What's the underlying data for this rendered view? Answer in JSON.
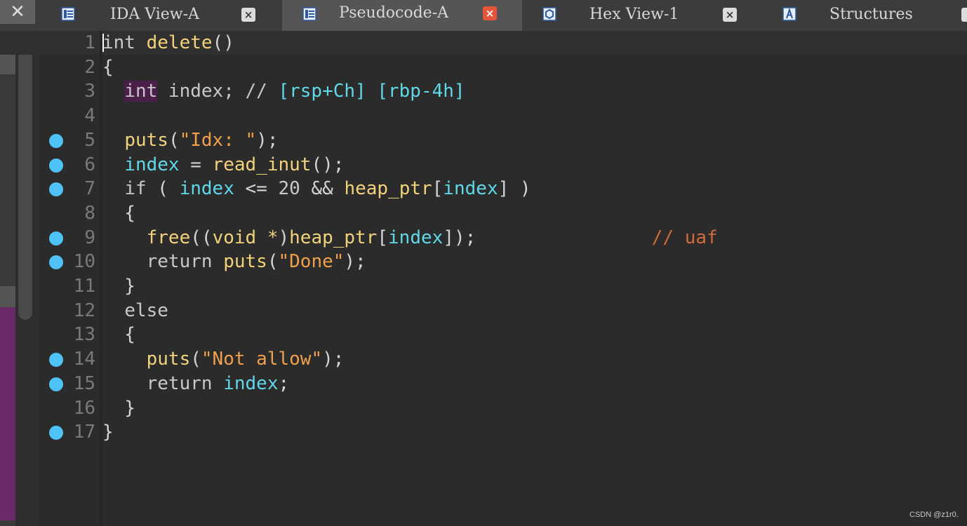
{
  "tabs": [
    {
      "label": "IDA View-A",
      "icon": "disassembly-view-icon",
      "active": false
    },
    {
      "label": "Pseudocode-A",
      "icon": "pseudocode-view-icon",
      "active": true
    },
    {
      "label": "Hex View-1",
      "icon": "hex-view-icon",
      "active": false
    },
    {
      "label": "Structures",
      "icon": "structures-icon",
      "active": false
    }
  ],
  "close_all_glyph": "✕",
  "tab_close_glyph": "×",
  "code": {
    "lines": [
      {
        "n": "1",
        "bp": false,
        "tokens": [
          {
            "t": "int",
            "c": "kw"
          },
          {
            "t": " ",
            "c": "punc"
          },
          {
            "t": "delete",
            "c": "fn"
          },
          {
            "t": "()",
            "c": "punc"
          }
        ]
      },
      {
        "n": "2",
        "bp": false,
        "tokens": [
          {
            "t": "{",
            "c": "punc"
          }
        ]
      },
      {
        "n": "3",
        "bp": false,
        "tokens": [
          {
            "t": "  ",
            "c": "punc"
          },
          {
            "t": "int",
            "c": "kw-bg"
          },
          {
            "t": " index; // ",
            "c": "kw"
          },
          {
            "t": "[rsp+Ch] [rbp-4h]",
            "c": "var"
          }
        ]
      },
      {
        "n": "4",
        "bp": false,
        "tokens": []
      },
      {
        "n": "5",
        "bp": true,
        "tokens": [
          {
            "t": "  ",
            "c": "punc"
          },
          {
            "t": "puts",
            "c": "fn"
          },
          {
            "t": "(",
            "c": "punc"
          },
          {
            "t": "\"Idx: \"",
            "c": "str"
          },
          {
            "t": ");",
            "c": "punc"
          }
        ]
      },
      {
        "n": "6",
        "bp": true,
        "tokens": [
          {
            "t": "  ",
            "c": "punc"
          },
          {
            "t": "index",
            "c": "var"
          },
          {
            "t": " = ",
            "c": "punc"
          },
          {
            "t": "read_inut",
            "c": "fn"
          },
          {
            "t": "();",
            "c": "punc"
          }
        ]
      },
      {
        "n": "7",
        "bp": true,
        "tokens": [
          {
            "t": "  ",
            "c": "punc"
          },
          {
            "t": "if",
            "c": "kw"
          },
          {
            "t": " ( ",
            "c": "punc"
          },
          {
            "t": "index",
            "c": "var"
          },
          {
            "t": " <= ",
            "c": "punc"
          },
          {
            "t": "20",
            "c": "num"
          },
          {
            "t": " && ",
            "c": "punc"
          },
          {
            "t": "heap_ptr",
            "c": "fn"
          },
          {
            "t": "[",
            "c": "punc"
          },
          {
            "t": "index",
            "c": "var"
          },
          {
            "t": "] )",
            "c": "punc"
          }
        ]
      },
      {
        "n": "8",
        "bp": false,
        "tokens": [
          {
            "t": "  {",
            "c": "punc"
          }
        ]
      },
      {
        "n": "9",
        "bp": true,
        "tokens": [
          {
            "t": "    ",
            "c": "punc"
          },
          {
            "t": "free",
            "c": "fn"
          },
          {
            "t": "((",
            "c": "punc"
          },
          {
            "t": "void *",
            "c": "fn"
          },
          {
            "t": ")",
            "c": "punc"
          },
          {
            "t": "heap_ptr",
            "c": "fn"
          },
          {
            "t": "[",
            "c": "punc"
          },
          {
            "t": "index",
            "c": "var"
          },
          {
            "t": "]);",
            "c": "punc"
          },
          {
            "t": "                // uaf",
            "c": "cmt"
          }
        ]
      },
      {
        "n": "10",
        "bp": true,
        "tokens": [
          {
            "t": "    ",
            "c": "punc"
          },
          {
            "t": "return",
            "c": "kw"
          },
          {
            "t": " ",
            "c": "punc"
          },
          {
            "t": "puts",
            "c": "fn"
          },
          {
            "t": "(",
            "c": "punc"
          },
          {
            "t": "\"Done\"",
            "c": "str"
          },
          {
            "t": ");",
            "c": "punc"
          }
        ]
      },
      {
        "n": "11",
        "bp": false,
        "tokens": [
          {
            "t": "  }",
            "c": "punc"
          }
        ]
      },
      {
        "n": "12",
        "bp": false,
        "tokens": [
          {
            "t": "  ",
            "c": "punc"
          },
          {
            "t": "else",
            "c": "kw"
          }
        ]
      },
      {
        "n": "13",
        "bp": false,
        "tokens": [
          {
            "t": "  {",
            "c": "punc"
          }
        ]
      },
      {
        "n": "14",
        "bp": true,
        "tokens": [
          {
            "t": "    ",
            "c": "punc"
          },
          {
            "t": "puts",
            "c": "fn"
          },
          {
            "t": "(",
            "c": "punc"
          },
          {
            "t": "\"Not allow\"",
            "c": "str"
          },
          {
            "t": ");",
            "c": "punc"
          }
        ]
      },
      {
        "n": "15",
        "bp": true,
        "tokens": [
          {
            "t": "    ",
            "c": "punc"
          },
          {
            "t": "return",
            "c": "kw"
          },
          {
            "t": " ",
            "c": "punc"
          },
          {
            "t": "index",
            "c": "var"
          },
          {
            "t": ";",
            "c": "punc"
          }
        ]
      },
      {
        "n": "16",
        "bp": false,
        "tokens": [
          {
            "t": "  }",
            "c": "punc"
          }
        ]
      },
      {
        "n": "17",
        "bp": true,
        "tokens": [
          {
            "t": "}",
            "c": "punc"
          }
        ]
      }
    ]
  },
  "colors": {
    "background": "#2b2b2b",
    "breakpoint": "#4fc3f7",
    "function": "#f2d27a",
    "variable": "#5fd8e8",
    "string": "#f0a04b",
    "comment": "#d16b3a"
  },
  "watermark": "CSDN @z1r0."
}
